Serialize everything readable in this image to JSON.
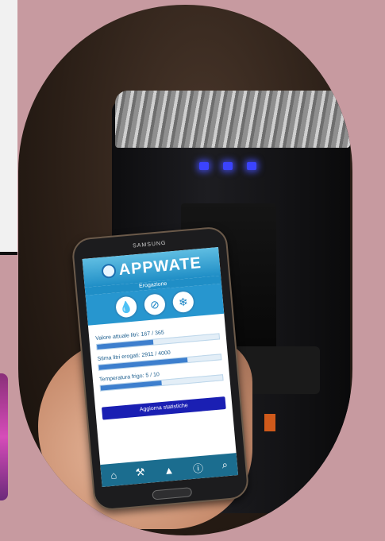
{
  "app": {
    "brand_text": "SAMSUNG",
    "title": "APPWATE",
    "subtitle": "Erogazione",
    "stats": [
      {
        "label": "Valore attuale litri: 167 / 365",
        "fill_fraction": 0.46
      },
      {
        "label": "Stima litri erogati: 2911 / 4000",
        "fill_fraction": 0.73
      },
      {
        "label": "Temperatura frigo: 5 / 10",
        "fill_fraction": 0.5
      }
    ],
    "update_button": "Aggiorna statistiche",
    "nav_icons": [
      "home-icon",
      "tools-icon",
      "warning-icon",
      "info-icon",
      "search-icon"
    ]
  },
  "colors": {
    "background": "#c79aa0",
    "accent": "#1f8ec6",
    "button": "#1a1fb3"
  }
}
